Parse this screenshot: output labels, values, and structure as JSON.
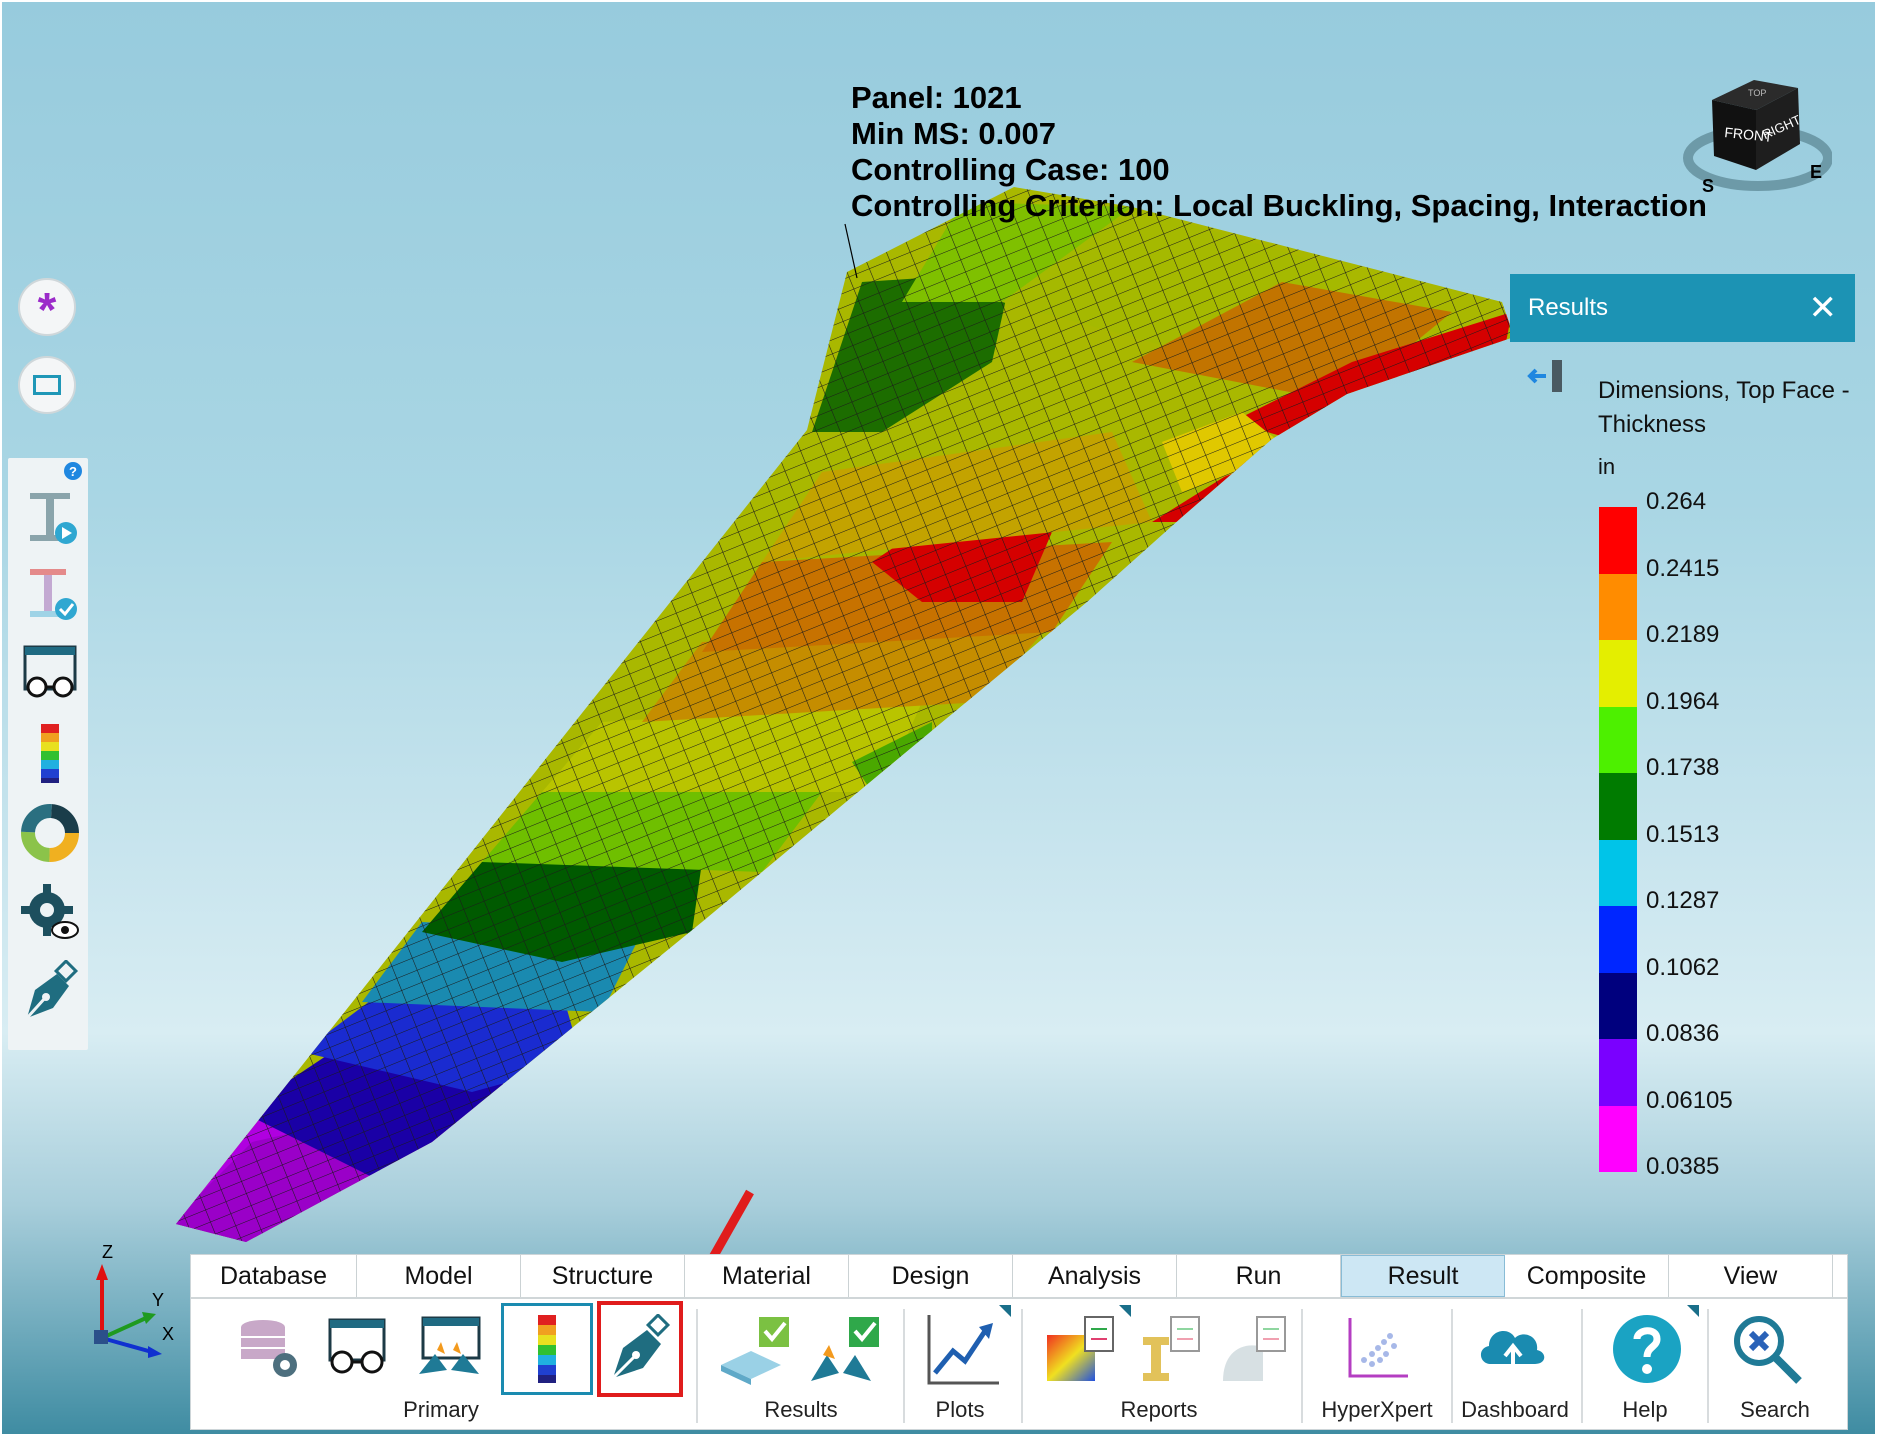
{
  "annotation": {
    "panel": "Panel: 1021",
    "min_ms": "Min MS: 0.007",
    "controlling_case": "Controlling Case: 100",
    "controlling_criterion": "Controlling Criterion: Local Buckling, Spacing, Interaction"
  },
  "viewcube": {
    "front": "FRONT",
    "right": "RIGHT",
    "top": "TOP",
    "south": "S",
    "east": "E"
  },
  "results_panel": {
    "title": "Results",
    "close_label": "✕",
    "legend_title": "Dimensions, Top Face - Thickness",
    "unit": "in",
    "legend_values": [
      "0.264",
      "0.2415",
      "0.2189",
      "0.1964",
      "0.1738",
      "0.1513",
      "0.1287",
      "0.1062",
      "0.0836",
      "0.06105",
      "0.0385"
    ],
    "legend_colors": [
      "#ff0000",
      "#ff8c00",
      "#e4ee00",
      "#4df000",
      "#007b00",
      "#00c4e8",
      "#0026ff",
      "#00007e",
      "#7a00ff",
      "#ff00ff"
    ]
  },
  "triad": {
    "x": "X",
    "y": "Y",
    "z": "Z"
  },
  "ribbon": {
    "tabs": [
      "Database",
      "Model",
      "Structure",
      "Material",
      "Design",
      "Analysis",
      "Run",
      "Result",
      "Composite",
      "View"
    ],
    "active_tab": "Result",
    "groups": {
      "primary": "Primary",
      "results": "Results",
      "plots": "Plots",
      "reports": "Reports",
      "hyperxpert": "HyperXpert",
      "dashboard": "Dashboard",
      "help": "Help",
      "search": "Search"
    }
  },
  "colors": {
    "accent": "#1c93b4",
    "highlight": "#e01c1c",
    "active_tab_bg": "#cde7f4"
  },
  "icons": [
    "asterisk-icon",
    "rectangle-icon",
    "help-badge-icon",
    "beam-run-icon",
    "beam-check-icon",
    "glasses-view-icon",
    "color-scale-icon",
    "donut-chart-icon",
    "gear-eye-icon",
    "pen-nib-icon",
    "database-gear-icon",
    "splash-icon",
    "results-check-icon",
    "line-plot-icon",
    "report-icon",
    "scatter-icon",
    "cloud-upload-icon",
    "question-icon",
    "search-icon"
  ]
}
